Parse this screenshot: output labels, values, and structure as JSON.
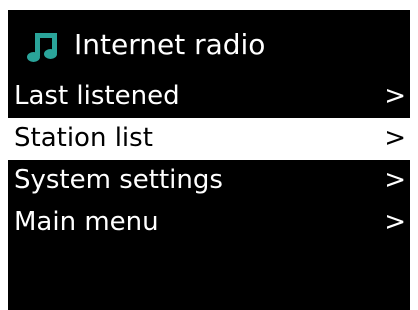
{
  "header": {
    "title": "Internet radio",
    "icon": "music-note-icon",
    "icon_color": "#2aa49a"
  },
  "menu": {
    "items": [
      {
        "label": "Last listened",
        "arrow": ">",
        "selected": false
      },
      {
        "label": "Station list",
        "arrow": ">",
        "selected": true
      },
      {
        "label": "System settings",
        "arrow": ">",
        "selected": false
      },
      {
        "label": "Main menu",
        "arrow": ">",
        "selected": false
      }
    ]
  },
  "colors": {
    "background": "#000000",
    "text": "#ffffff",
    "highlight_background": "#ffffff",
    "highlight_text": "#000000"
  }
}
